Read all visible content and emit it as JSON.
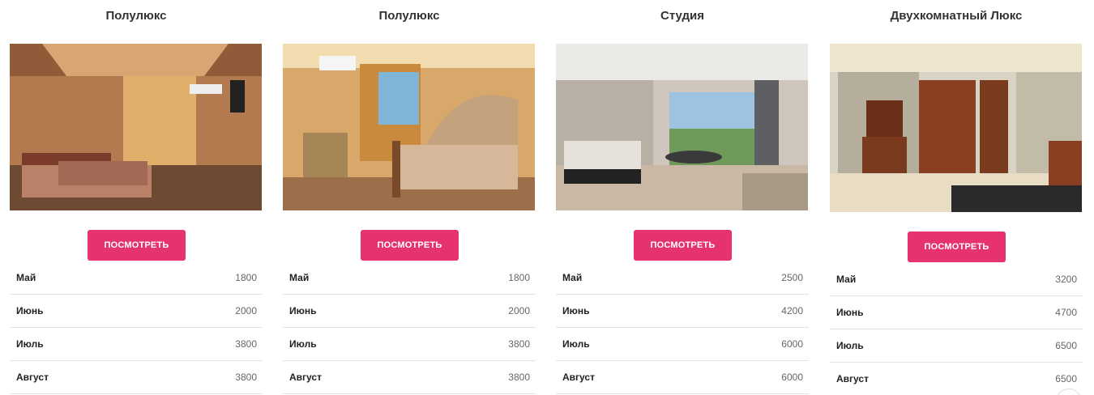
{
  "cards": [
    {
      "title": "Полулюкс",
      "button": "ПОСМОТРЕТЬ",
      "prices": [
        {
          "month": "Май",
          "value": "1800"
        },
        {
          "month": "Июнь",
          "value": "2000"
        },
        {
          "month": "Июль",
          "value": "3800"
        },
        {
          "month": "Август",
          "value": "3800"
        }
      ]
    },
    {
      "title": "Полулюкс",
      "button": "ПОСМОТРЕТЬ",
      "prices": [
        {
          "month": "Май",
          "value": "1800"
        },
        {
          "month": "Июнь",
          "value": "2000"
        },
        {
          "month": "Июль",
          "value": "3800"
        },
        {
          "month": "Август",
          "value": "3800"
        }
      ]
    },
    {
      "title": "Студия",
      "button": "ПОСМОТРЕТЬ",
      "prices": [
        {
          "month": "Май",
          "value": "2500"
        },
        {
          "month": "Июнь",
          "value": "4200"
        },
        {
          "month": "Июль",
          "value": "6000"
        },
        {
          "month": "Август",
          "value": "6000"
        }
      ]
    },
    {
      "title": "Двухкомнатный Люкс",
      "button": "ПОСМОТРЕТЬ",
      "prices": [
        {
          "month": "Май",
          "value": "3200"
        },
        {
          "month": "Июнь",
          "value": "4700"
        },
        {
          "month": "Июль",
          "value": "6500"
        },
        {
          "month": "Август",
          "value": "6500"
        }
      ]
    }
  ],
  "colors": {
    "accent": "#e6336f"
  }
}
